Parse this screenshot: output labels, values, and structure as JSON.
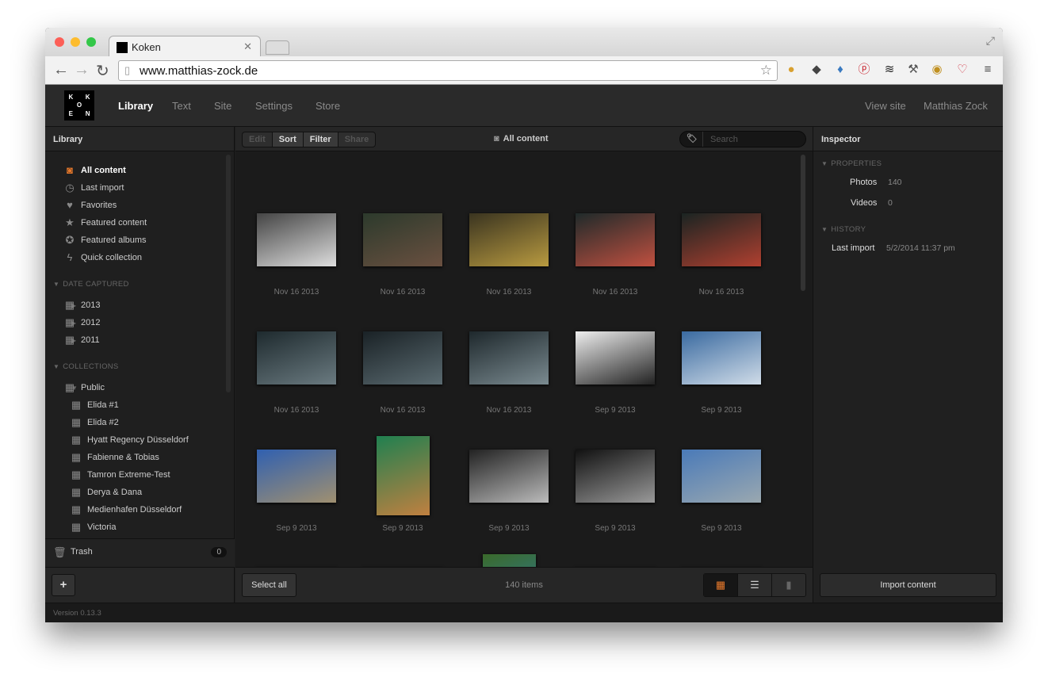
{
  "browser": {
    "tab_title": "Koken",
    "url": "www.matthias-zock.de"
  },
  "header": {
    "logo": [
      "K",
      "",
      "K",
      "",
      "O",
      "",
      "E",
      "",
      "N"
    ],
    "nav": [
      "Library",
      "Text",
      "Site",
      "Settings",
      "Store"
    ],
    "view_site": "View site",
    "user": "Matthias Zock"
  },
  "library": {
    "title": "Library",
    "items": [
      {
        "label": "All content",
        "icon": "camera-icon"
      },
      {
        "label": "Last import",
        "icon": "clock-icon"
      },
      {
        "label": "Favorites",
        "icon": "heart-icon"
      },
      {
        "label": "Featured content",
        "icon": "star-icon"
      },
      {
        "label": "Featured albums",
        "icon": "star-album-icon"
      },
      {
        "label": "Quick collection",
        "icon": "lightning-icon"
      }
    ],
    "date_section": "DATE CAPTURED",
    "years": [
      "2013",
      "2012",
      "2011"
    ],
    "collections_section": "COLLECTIONS",
    "public_label": "Public",
    "albums": [
      "Elida #1",
      "Elida #2",
      "Hyatt Regency Düsseldorf",
      "Fabienne & Tobias",
      "Tamron Extreme-Test",
      "Derya & Dana",
      "Medienhafen Düsseldorf",
      "Victoria"
    ],
    "trash": "Trash",
    "trash_count": "0",
    "add": "+"
  },
  "toolbar": {
    "edit": "Edit",
    "sort": "Sort",
    "filter": "Filter",
    "share": "Share",
    "title": "All content",
    "search_placeholder": "Search"
  },
  "grid": {
    "items": [
      {
        "date": "Nov 16 2013",
        "c": [
          "#444",
          "#ddd"
        ],
        "o": "l"
      },
      {
        "date": "Nov 16 2013",
        "c": [
          "#2c3a2c",
          "#6a5040"
        ],
        "o": "l"
      },
      {
        "date": "Nov 16 2013",
        "c": [
          "#3a3420",
          "#b89a40"
        ],
        "o": "l"
      },
      {
        "date": "Nov 16 2013",
        "c": [
          "#1f2a2a",
          "#c05040"
        ],
        "o": "l"
      },
      {
        "date": "Nov 16 2013",
        "c": [
          "#1a2422",
          "#b04030"
        ],
        "o": "l"
      },
      {
        "date": "Nov 16 2013",
        "c": [
          "#1e2a2e",
          "#6a7a80"
        ],
        "o": "l"
      },
      {
        "date": "Nov 16 2013",
        "c": [
          "#1a2226",
          "#5a6a70"
        ],
        "o": "l"
      },
      {
        "date": "Nov 16 2013",
        "c": [
          "#1e282c",
          "#7a8a90"
        ],
        "o": "l"
      },
      {
        "date": "Sep 9 2013",
        "c": [
          "#eee",
          "#222"
        ],
        "o": "l"
      },
      {
        "date": "Sep 9 2013",
        "c": [
          "#3a6aa0",
          "#d0dce8"
        ],
        "o": "l"
      },
      {
        "date": "Sep 9 2013",
        "c": [
          "#3060b0",
          "#a09070"
        ],
        "o": "l"
      },
      {
        "date": "Sep 9 2013",
        "c": [
          "#208050",
          "#c08040"
        ],
        "o": "p"
      },
      {
        "date": "Sep 9 2013",
        "c": [
          "#222",
          "#bbb"
        ],
        "o": "l"
      },
      {
        "date": "Sep 9 2013",
        "c": [
          "#111",
          "#999"
        ],
        "o": "l"
      },
      {
        "date": "Sep 9 2013",
        "c": [
          "#4a7ab8",
          "#9aa8b0"
        ],
        "o": "l"
      },
      {
        "date": "",
        "c": [
          "#9ab0c0",
          "#607080"
        ],
        "o": "l"
      },
      {
        "date": "",
        "c": [
          "#c8c8c0",
          "#807060"
        ],
        "o": "l"
      },
      {
        "date": "",
        "c": [
          "#3a6a2a",
          "#2a80c0"
        ],
        "o": "p"
      },
      {
        "date": "",
        "c": [
          "#2a6a2a",
          "#c07050"
        ],
        "o": "l"
      },
      {
        "date": "",
        "c": [
          "#e8e8e0",
          "#60a050"
        ],
        "o": "l"
      }
    ]
  },
  "footer": {
    "select_all": "Select all",
    "count": "140 items",
    "import": "Import content"
  },
  "inspector": {
    "title": "Inspector",
    "properties": "PROPERTIES",
    "photos_label": "Photos",
    "photos": "140",
    "videos_label": "Videos",
    "videos": "0",
    "history": "HISTORY",
    "last_import_label": "Last import",
    "last_import": "5/2/2014 11:37 pm"
  },
  "version": "Version 0.13.3",
  "colors": {
    "accent": "#e8792b"
  }
}
